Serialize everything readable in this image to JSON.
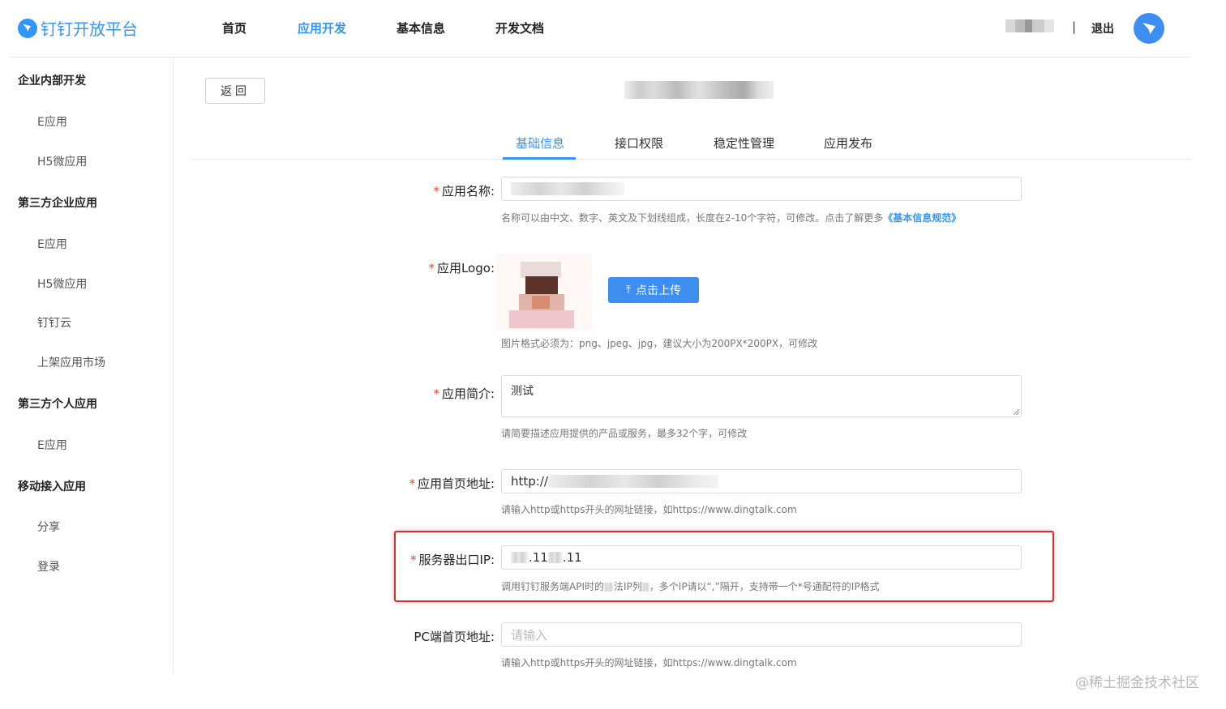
{
  "header": {
    "brand": "钉钉开放平台",
    "nav": [
      "首页",
      "应用开发",
      "基本信息",
      "开发文档"
    ],
    "nav_active_index": 1,
    "separator": "|",
    "logout": "退出"
  },
  "sidebar": {
    "groups": [
      {
        "label": "企业内部开发",
        "items": [
          "E应用",
          "H5微应用"
        ]
      },
      {
        "label": "第三方企业应用",
        "items": [
          "E应用",
          "H5微应用",
          "钉钉云",
          "上架应用市场"
        ]
      },
      {
        "label": "第三方个人应用",
        "items": [
          "E应用"
        ]
      },
      {
        "label": "移动接入应用",
        "items": [
          "分享",
          "登录"
        ]
      }
    ]
  },
  "main": {
    "back": "返回",
    "tabs": [
      "基础信息",
      "接口权限",
      "稳定性管理",
      "应用发布"
    ],
    "active_tab": 0,
    "form": {
      "name": {
        "label": "应用名称:",
        "required": true,
        "hint": "名称可以由中文、数字、英文及下划线组成，长度在2-10个字符，可修改。点击了解更多",
        "hint_link": "《基本信息规范》"
      },
      "logo": {
        "label": "应用Logo:",
        "required": true,
        "upload": "点击上传",
        "hint": "图片格式必须为：png、jpeg、jpg，建议大小为200PX*200PX，可修改"
      },
      "intro": {
        "label": "应用简介:",
        "required": true,
        "value": "测试",
        "hint": "请简要描述应用提供的产品或服务，最多32个字，可修改"
      },
      "homepage": {
        "label": "应用首页地址:",
        "required": true,
        "value": "http://",
        "hint": "请输入http或https开头的网址链接，如https://www.dingtalk.com"
      },
      "server_ip": {
        "label": "服务器出口IP:",
        "required": true,
        "value_a": ".11",
        "value_b": ".11",
        "hint_a": "调用钉钉服务端API时的",
        "hint_b": "法IP列",
        "hint_c": "，多个IP请以“,”隔开，支持带一个*号通配符的IP格式"
      },
      "pc_homepage": {
        "label": "PC端首页地址:",
        "required": false,
        "placeholder": "请输入",
        "hint": "请输入http或https开头的网址链接，如https://www.dingtalk.com"
      }
    }
  },
  "watermark": "@稀土掘金技术社区",
  "colors": {
    "accent": "#3296fa",
    "required": "#e84a3a",
    "highlight": "#d32f2f"
  }
}
